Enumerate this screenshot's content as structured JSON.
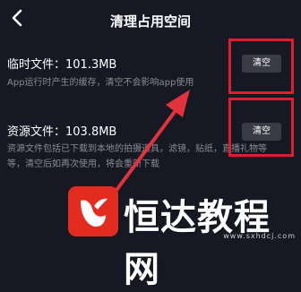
{
  "header": {
    "title": "清理占用空间",
    "back_icon": "chevron-left-icon"
  },
  "temp_files": {
    "title": "临时文件：101.3MB",
    "description": "App运行时产生的缓存，清空不会影响app使用",
    "button_label": "清空"
  },
  "resource_files": {
    "title": "资源文件：103.8MB",
    "description_line1": "资源文件包括已下载到本地的拍摄道具，滤镜，贴纸，直播礼物等",
    "description_line2": "等，清空后如再次使用，将会重新下载",
    "button_label": "清空"
  },
  "annotation": {
    "highlight_color": "#e01d2e",
    "arrow_color": "#e2323b"
  },
  "watermark": {
    "brand_text": "恒达教程网",
    "url_text": "www.sxhdcj.com",
    "accent_color": "#e42b1f"
  }
}
